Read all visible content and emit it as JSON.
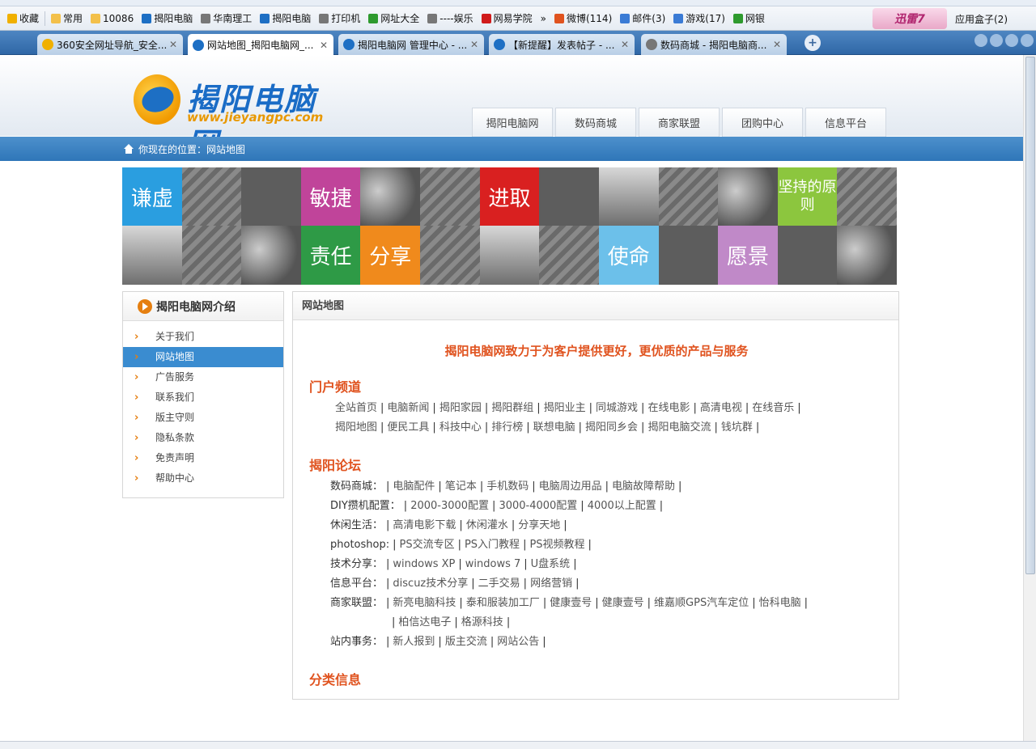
{
  "browser": {
    "favorites": [
      {
        "label": "收藏",
        "color": "#f0b000"
      },
      {
        "label": "常用",
        "color": "#f3c04a"
      },
      {
        "label": "10086",
        "color": "#f3c04a"
      },
      {
        "label": "揭阳电脑",
        "color": "#1d6fc4"
      },
      {
        "label": "华南理工",
        "color": "#777777"
      },
      {
        "label": "揭阳电脑",
        "color": "#1d6fc4"
      },
      {
        "label": "打印机",
        "color": "#777777"
      },
      {
        "label": "网址大全",
        "color": "#2e9a2e"
      },
      {
        "label": "----娱乐",
        "color": "#777777"
      },
      {
        "label": "网易学院",
        "color": "#d01b1b"
      },
      {
        "label": "»",
        "color": ""
      },
      {
        "label": "微博(114)",
        "color": "#e0531f"
      },
      {
        "label": "邮件(3)",
        "color": "#3a7bd5"
      },
      {
        "label": "游戏(17)",
        "color": "#3a7bd5"
      },
      {
        "label": "网银",
        "color": "#2e9a2e"
      }
    ],
    "xunlei": "迅雷7",
    "app_box": "应用盒子(2)",
    "tabs": [
      {
        "title": "360安全网址导航_安全...",
        "active": false,
        "color": "#f0b000"
      },
      {
        "title": "网站地图_揭阳电脑网_...",
        "active": true,
        "color": "#1d6fc4"
      },
      {
        "title": "揭阳电脑网 管理中心 - ...",
        "active": false,
        "color": "#1d6fc4"
      },
      {
        "title": "【新提醒】发表帖子 - ...",
        "active": false,
        "color": "#1d6fc4"
      },
      {
        "title": "数码商城 - 揭阳电脑商...",
        "active": false,
        "color": "#777777"
      }
    ],
    "close_glyph": "✕",
    "new_tab_glyph": "+"
  },
  "site": {
    "logo_name": "揭阳电脑网",
    "logo_url": "www.jieyangpc.com",
    "nav": [
      "揭阳电脑网",
      "数码商城",
      "商家联盟",
      "团购中心",
      "信息平台"
    ],
    "location": "你现在的位置：网站地图"
  },
  "banner": {
    "words": [
      "谦虚",
      "敏捷",
      "进取",
      "坚持的原则",
      "责任",
      "分享",
      "使命",
      "愿景"
    ],
    "word_colors": {
      "谦虚": "#2a9ee0",
      "敏捷": "#c0449a",
      "进取": "#d92020",
      "坚持的原则": "#8cc63e",
      "责任": "#2e9a46",
      "分享": "#f08a1c",
      "使命": "#6cc0ea",
      "愿景": "#c089c8"
    }
  },
  "sidebar": {
    "title": "揭阳电脑网介绍",
    "items": [
      "关于我们",
      "网站地图",
      "广告服务",
      "联系我们",
      "版主守则",
      "隐私条款",
      "免责声明",
      "帮助中心"
    ],
    "selected": "网站地图"
  },
  "content": {
    "header": "网站地图",
    "slogan": "揭阳电脑网致力于为客户提供更好，更优质的产品与服务",
    "portal_title": "门户频道",
    "portal_links_1": [
      "全站首页",
      "电脑新闻",
      "揭阳家园",
      "揭阳群组",
      "揭阳业主",
      "同城游戏",
      "在线电影",
      "高清电视",
      "在线音乐"
    ],
    "portal_links_2": [
      "揭阳地图",
      "便民工具",
      "科技中心",
      "排行榜",
      "联想电脑",
      "揭阳同乡会",
      "揭阳电脑交流",
      "钱坑群"
    ],
    "forum_title": "揭阳论坛",
    "forum_rows": [
      {
        "label": "数码商城：",
        "links": [
          "电脑配件",
          "笔记本",
          "手机数码",
          "电脑周边用品",
          "电脑故障帮助"
        ]
      },
      {
        "label": "DIY攒机配置：",
        "links": [
          "2000-3000配置",
          "3000-4000配置",
          "4000以上配置"
        ]
      },
      {
        "label": "休闲生活：",
        "links": [
          "高清电影下载",
          "休闲灌水",
          "分享天地"
        ]
      },
      {
        "label": "photoshop:",
        "links": [
          "PS交流专区",
          "PS入门教程",
          "PS视频教程"
        ]
      },
      {
        "label": "技术分享：",
        "links": [
          "windows XP",
          "windows 7",
          "U盘系统"
        ]
      },
      {
        "label": "信息平台：",
        "links": [
          "discuz技术分享",
          "二手交易",
          "网络营销"
        ]
      },
      {
        "label": "商家联盟：",
        "links": [
          "新亮电脑科技",
          "泰和服装加工厂",
          "健康壹号",
          "健康壹号",
          "维嘉顺GPS汽车定位",
          "怡科电脑"
        ]
      },
      {
        "label": "",
        "links": [
          "柏信达电子",
          "格源科技"
        ]
      },
      {
        "label": "站内事务：",
        "links": [
          "新人报到",
          "版主交流",
          "网站公告"
        ]
      }
    ],
    "classified_title": "分类信息"
  }
}
